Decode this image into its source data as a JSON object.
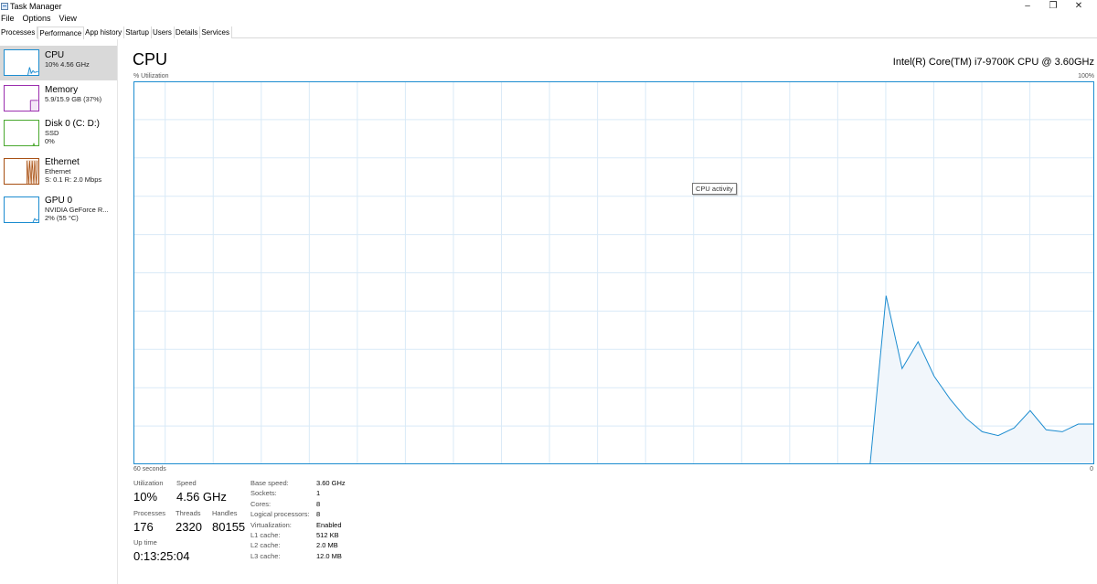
{
  "window": {
    "title": "Task Manager"
  },
  "menu": [
    "File",
    "Options",
    "View"
  ],
  "tabs": [
    "Processes",
    "Performance",
    "App history",
    "Startup",
    "Users",
    "Details",
    "Services"
  ],
  "active_tab": "Performance",
  "sidebar": {
    "items": [
      {
        "title": "CPU",
        "sub1": "10%  4.56 GHz",
        "sub2": "",
        "color": "#1c8cd0"
      },
      {
        "title": "Memory",
        "sub1": "5.9/15.9 GB (37%)",
        "sub2": "",
        "color": "#9b2fae"
      },
      {
        "title": "Disk 0 (C: D:)",
        "sub1": "SSD",
        "sub2": "0%",
        "color": "#4aa82f"
      },
      {
        "title": "Ethernet",
        "sub1": "Ethernet",
        "sub2": "S: 0.1  R: 2.0 Mbps",
        "color": "#a74f12"
      },
      {
        "title": "GPU 0",
        "sub1": "NVIDIA GeForce R...",
        "sub2": "2%  (55 °C)",
        "color": "#1c8cd0"
      }
    ]
  },
  "main": {
    "title": "CPU",
    "cpu_name": "Intel(R) Core(TM) i7-9700K CPU @ 3.60GHz",
    "y_axis_label": "% Utilization",
    "y_max_label": "100%",
    "x_left_label": "60 seconds",
    "x_right_label": "0",
    "tooltip": "CPU activity"
  },
  "chart_data": {
    "type": "area",
    "x": [
      0,
      2,
      4,
      6,
      8,
      10,
      12,
      14,
      16,
      18,
      20,
      22,
      24,
      26,
      28,
      30,
      32,
      34,
      36,
      38,
      40,
      42,
      44,
      46,
      48,
      50,
      52,
      54,
      56,
      58,
      60
    ],
    "values": [
      0,
      0,
      0,
      0,
      0,
      0,
      0,
      0,
      0,
      0,
      0,
      0,
      0,
      0,
      0,
      0,
      0,
      0,
      0,
      0,
      0,
      0,
      0,
      0,
      0,
      0,
      0,
      0,
      0,
      0,
      0
    ],
    "recent_values": [
      0,
      44,
      25,
      32,
      23,
      17,
      12,
      8.5,
      7.5,
      9.5,
      14,
      9,
      8.5,
      10.5,
      10.5
    ],
    "recent_x": [
      46,
      47,
      48,
      49,
      50,
      51,
      52,
      53,
      54,
      55,
      56,
      57,
      58,
      59,
      60
    ],
    "ylim": [
      0,
      100
    ],
    "xlim": [
      0,
      60
    ],
    "grid": true,
    "line_color": "#1c8cd0",
    "fill_color": "#f1f6fb",
    "grid_color": "#d9eaf7"
  },
  "stats": {
    "utilization_label": "Utilization",
    "utilization": "10%",
    "speed_label": "Speed",
    "speed": "4.56 GHz",
    "processes_label": "Processes",
    "processes": "176",
    "threads_label": "Threads",
    "threads": "2320",
    "handles_label": "Handles",
    "handles": "80155",
    "uptime_label": "Up time",
    "uptime": "0:13:25:04"
  },
  "specs": [
    {
      "label": "Base speed:",
      "value": "3.60 GHz"
    },
    {
      "label": "Sockets:",
      "value": "1"
    },
    {
      "label": "Cores:",
      "value": "8"
    },
    {
      "label": "Logical processors:",
      "value": "8"
    },
    {
      "label": "Virtualization:",
      "value": "Enabled"
    },
    {
      "label": "L1 cache:",
      "value": "512 KB"
    },
    {
      "label": "L2 cache:",
      "value": "2.0 MB"
    },
    {
      "label": "L3 cache:",
      "value": "12.0 MB"
    }
  ]
}
